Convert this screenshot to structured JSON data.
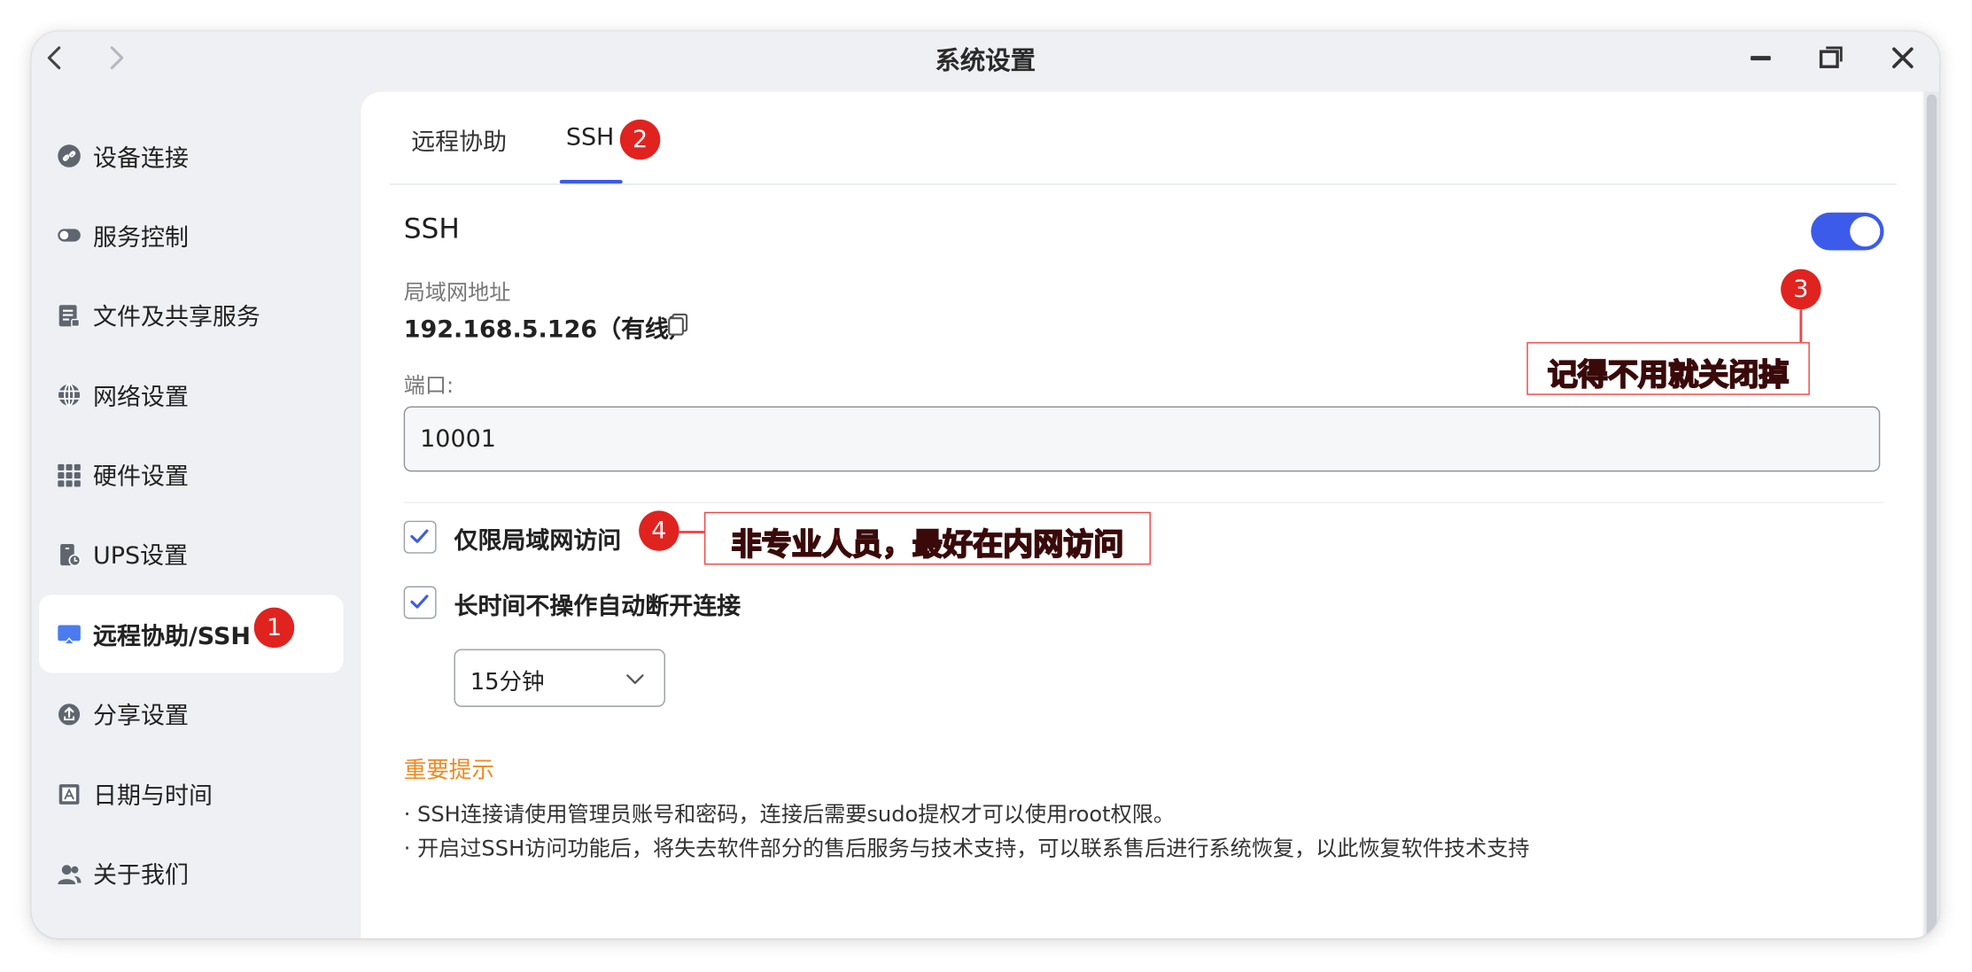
{
  "window": {
    "title": "系统设置"
  },
  "sidebar": {
    "items": [
      {
        "label": "设备连接",
        "icon": "link-icon"
      },
      {
        "label": "服务控制",
        "icon": "toggle-icon"
      },
      {
        "label": "文件及共享服务",
        "icon": "file-share-icon"
      },
      {
        "label": "网络设置",
        "icon": "globe-icon"
      },
      {
        "label": "硬件设置",
        "icon": "grid-icon"
      },
      {
        "label": "UPS设置",
        "icon": "ups-icon"
      },
      {
        "label": "远程协助/SSH",
        "icon": "monitor-icon",
        "active": true
      },
      {
        "label": "分享设置",
        "icon": "share-icon"
      },
      {
        "label": "日期与时间",
        "icon": "calendar-icon"
      },
      {
        "label": "关于我们",
        "icon": "users-icon"
      }
    ]
  },
  "tabs": [
    {
      "label": "远程协助"
    },
    {
      "label": "SSH",
      "active": true
    }
  ],
  "ssh": {
    "title": "SSH",
    "enabled": true,
    "lan_label": "局域网地址",
    "lan_value": "192.168.5.126（有线）",
    "port_label": "端口:",
    "port_value": "10001",
    "lan_only_label": "仅限局域网访问",
    "lan_only_checked": true,
    "auto_disconnect_label": "长时间不操作自动断开连接",
    "auto_disconnect_checked": true,
    "timeout_value": "15分钟"
  },
  "notice": {
    "title": "重要提示",
    "lines": [
      "· SSH连接请使用管理员账号和密码，连接后需要sudo提权才可以使用root权限。",
      "· 开启过SSH访问功能后，将失去软件部分的售后服务与技术支持，可以联系售后进行系统恢复，以此恢复软件技术支持"
    ]
  },
  "annotations": {
    "badges": [
      "1",
      "2",
      "3",
      "4"
    ],
    "note3": "记得不用就关闭掉",
    "note4": "非专业人员，最好在内网访问"
  },
  "colors": {
    "accent": "#3d5bea",
    "notice": "#ee8a22",
    "annotation": "#e0231f",
    "window_bg": "#eef0f4"
  }
}
